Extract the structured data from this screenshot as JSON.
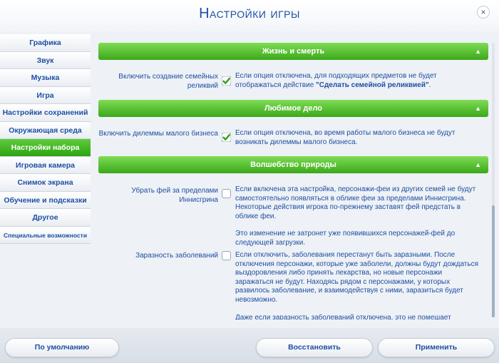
{
  "window": {
    "title": "Настройки игры",
    "close": "×"
  },
  "sidebar": {
    "items": [
      {
        "label": "Графика"
      },
      {
        "label": "Звук"
      },
      {
        "label": "Музыка"
      },
      {
        "label": "Игра"
      },
      {
        "label": "Настройки сохранений"
      },
      {
        "label": "Окружающая среда"
      },
      {
        "label": "Настройки набора"
      },
      {
        "label": "Игровая камера"
      },
      {
        "label": "Снимок экрана"
      },
      {
        "label": "Обучение и подсказки"
      },
      {
        "label": "Другое"
      },
      {
        "label": "Специальные возможности"
      }
    ],
    "active_index": 6
  },
  "sections": [
    {
      "title": "Жизнь и смерть",
      "options": [
        {
          "label": "Включить создание семейных реликвий",
          "checked": true,
          "desc_1": "Если опция отключена, для подходящих предметов не будет отображаться действие ",
          "desc_bold": "\"Сделать семейной реликвией\"",
          "desc_2": "."
        }
      ]
    },
    {
      "title": "Любимое дело",
      "options": [
        {
          "label": "Включить дилеммы малого бизнеса",
          "checked": true,
          "desc_1": "Если опция отключена, во время работы малого бизнеса не будут возникать дилеммы малого бизнеса."
        }
      ]
    },
    {
      "title": "Волшебство природы",
      "options": [
        {
          "label": "Убрать фей за пределами Иннисгрина",
          "checked": false,
          "desc_1": "Если включена эта настройка, персонажи-феи из других семей не будут самостоятельно появляться в облике феи за пределами Иннисгрина. Некоторые действия игрока по-прежнему заставят фей предстать в облике феи.",
          "desc_p2": "Это изменение не затронет уже появившихся персонажей-фей до следующей загрузки."
        },
        {
          "label": "Заразность заболеваний",
          "checked": false,
          "desc_1": "Если отключить, заболевания перестанут быть заразными. После отключения персонажи, которые уже заболели, должны будут дождаться выздоровления либо принять лекарства, но новые персонажи заражаться не будут. Находясь рядом с персонажами, у которых развилось заболевание, и взаимодействуя с ними, заразиться будет невозможно.",
          "desc_p2": "Даже если заразность заболеваний отключена, это не помешает"
        }
      ]
    }
  ],
  "footer": {
    "default_label": "По умолчанию",
    "restore_label": "Восстановить",
    "apply_label": "Применить"
  },
  "colors": {
    "accent": "#3aa819",
    "text": "#1d4fa3"
  }
}
